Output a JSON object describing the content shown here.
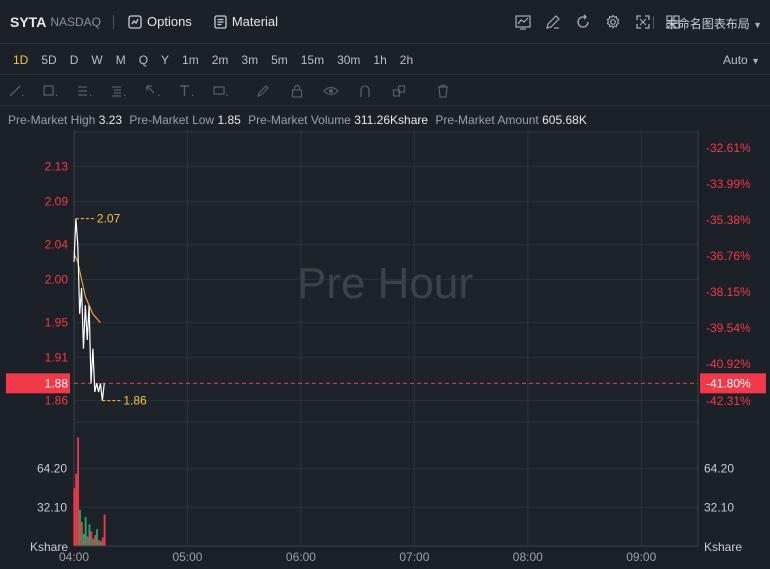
{
  "header": {
    "symbol": "SYTA",
    "exchange": "NASDAQ",
    "options_label": "Options",
    "material_label": "Material",
    "layout_name": "未命名图表布局"
  },
  "periods": [
    "1D",
    "5D",
    "D",
    "W",
    "M",
    "Q",
    "Y",
    "1m",
    "2m",
    "3m",
    "5m",
    "15m",
    "30m",
    "1h",
    "2h"
  ],
  "active_period": "1D",
  "scale_mode": "Auto",
  "premarket": {
    "high_label": "Pre-Market High",
    "high": "3.23",
    "low_label": "Pre-Market Low",
    "low": "1.85",
    "volume_label": "Pre-Market Volume",
    "volume": "311.26Kshare",
    "amount_label": "Pre-Market Amount",
    "amount": "605.68K"
  },
  "watermark": "Pre Hour",
  "price_axis": {
    "ticks": [
      "2.13",
      "2.09",
      "2.04",
      "2.00",
      "1.95",
      "1.91",
      "1.86"
    ],
    "current_price": "1.88",
    "current_pct": "-41.80%"
  },
  "pct_axis": {
    "ticks": [
      "-32.61%",
      "-33.99%",
      "-35.38%",
      "-36.76%",
      "-38.15%",
      "-39.54%",
      "-40.92%",
      "-42.31%"
    ]
  },
  "annotations": {
    "high": "2.07",
    "low": "1.86"
  },
  "volume_axis": {
    "ticks": [
      "64.20",
      "32.10"
    ],
    "unit": "Kshare"
  },
  "time_axis": [
    "04:00",
    "05:00",
    "06:00",
    "07:00",
    "08:00",
    "09:00"
  ],
  "colors": {
    "up": "#f2394a",
    "down": "#22ab70",
    "accent": "#f5c542",
    "price_line": "#ffffff",
    "avg_line": "#e8a23d",
    "grid": "#2c333c"
  },
  "chart_data": {
    "type": "line",
    "price_series": [
      {
        "t": "04:00",
        "v": 2.02
      },
      {
        "t": "04:01",
        "v": 2.07
      },
      {
        "t": "04:02",
        "v": 2.04
      },
      {
        "t": "04:03",
        "v": 1.96
      },
      {
        "t": "04:04",
        "v": 1.99
      },
      {
        "t": "04:05",
        "v": 1.92
      },
      {
        "t": "04:06",
        "v": 1.97
      },
      {
        "t": "04:07",
        "v": 1.93
      },
      {
        "t": "04:08",
        "v": 1.97
      },
      {
        "t": "04:09",
        "v": 1.88
      },
      {
        "t": "04:10",
        "v": 1.92
      },
      {
        "t": "04:11",
        "v": 1.87
      },
      {
        "t": "04:12",
        "v": 1.88
      },
      {
        "t": "04:13",
        "v": 1.87
      },
      {
        "t": "04:14",
        "v": 1.88
      },
      {
        "t": "04:15",
        "v": 1.86
      },
      {
        "t": "04:16",
        "v": 1.88
      }
    ],
    "avg_series": [
      {
        "t": "04:00",
        "v": 2.03
      },
      {
        "t": "04:02",
        "v": 2.02
      },
      {
        "t": "04:04",
        "v": 2.0
      },
      {
        "t": "04:06",
        "v": 1.98
      },
      {
        "t": "04:08",
        "v": 1.97
      },
      {
        "t": "04:10",
        "v": 1.96
      },
      {
        "t": "04:12",
        "v": 1.955
      },
      {
        "t": "04:14",
        "v": 1.95
      }
    ],
    "volume": [
      {
        "t": "04:00",
        "v": 48,
        "dir": "up"
      },
      {
        "t": "04:01",
        "v": 60,
        "dir": "up"
      },
      {
        "t": "04:02",
        "v": 90,
        "dir": "up"
      },
      {
        "t": "04:03",
        "v": 30,
        "dir": "down"
      },
      {
        "t": "04:04",
        "v": 20,
        "dir": "up"
      },
      {
        "t": "04:05",
        "v": 10,
        "dir": "down"
      },
      {
        "t": "04:06",
        "v": 24,
        "dir": "down"
      },
      {
        "t": "04:07",
        "v": 8,
        "dir": "up"
      },
      {
        "t": "04:08",
        "v": 18,
        "dir": "down"
      },
      {
        "t": "04:09",
        "v": 12,
        "dir": "up"
      },
      {
        "t": "04:10",
        "v": 6,
        "dir": "down"
      },
      {
        "t": "04:11",
        "v": 9,
        "dir": "up"
      },
      {
        "t": "04:12",
        "v": 14,
        "dir": "down"
      },
      {
        "t": "04:13",
        "v": 5,
        "dir": "up"
      },
      {
        "t": "04:14",
        "v": 4,
        "dir": "down"
      },
      {
        "t": "04:15",
        "v": 7,
        "dir": "up"
      },
      {
        "t": "04:16",
        "v": 26,
        "dir": "up"
      }
    ],
    "ylim": [
      1.84,
      2.17
    ],
    "volume_max": 96.3,
    "x_range": [
      "04:00",
      "09:30"
    ]
  }
}
